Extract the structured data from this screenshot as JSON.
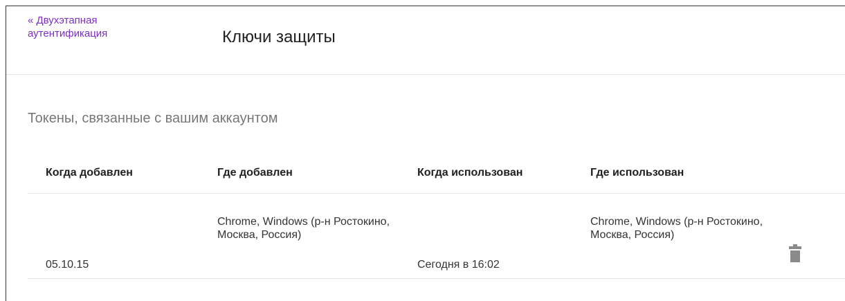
{
  "header": {
    "back_link": "« Двухэтапная аутентификация",
    "title": "Ключи защиты"
  },
  "section": {
    "title": "Токены, связанные с вашим аккаунтом"
  },
  "table": {
    "columns": [
      "Когда добавлен",
      "Где добавлен",
      "Когда использован",
      "Где использован"
    ],
    "rows": [
      {
        "added_when": "05.10.15",
        "added_where": "Chrome, Windows (р-н Ростокино, Москва, Россия)",
        "used_when": "Сегодня в 16:02",
        "used_where": "Chrome, Windows (р-н Ростокино, Москва, Россия)",
        "delete_icon": "trash-icon"
      }
    ]
  },
  "colors": {
    "link": "#7b2fc4",
    "muted_text": "#777777",
    "icon": "#8a8a8a"
  }
}
